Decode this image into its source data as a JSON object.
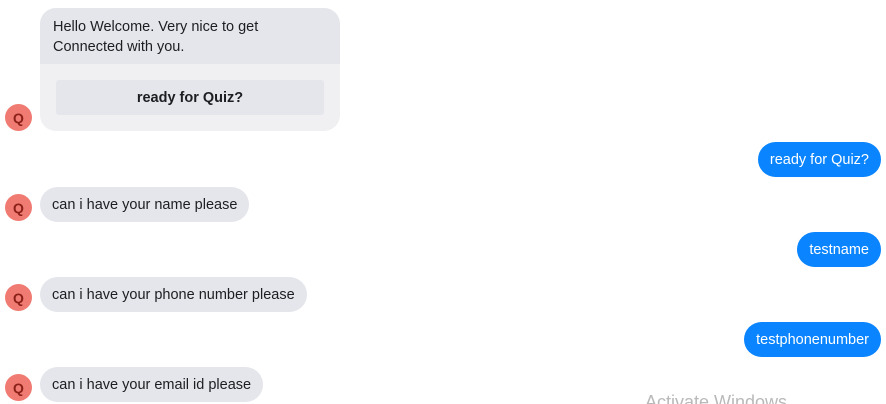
{
  "avatar_letter": "Q",
  "welcome": {
    "text": "Hello Welcome. Very nice to get\nConnected with you.",
    "button_label": "ready for Quiz?"
  },
  "messages": {
    "user_1": "ready for Quiz?",
    "bot_1": "can i have your name please",
    "user_2": "testname",
    "bot_2": "can i have your phone number please",
    "user_3": "testphonenumber",
    "bot_3": "can i have your email id please"
  },
  "watermark": "Activate Windows",
  "colors": {
    "bot_bubble": "#e4e6eb",
    "user_bubble": "#0a84ff",
    "avatar": "#f07b72"
  }
}
